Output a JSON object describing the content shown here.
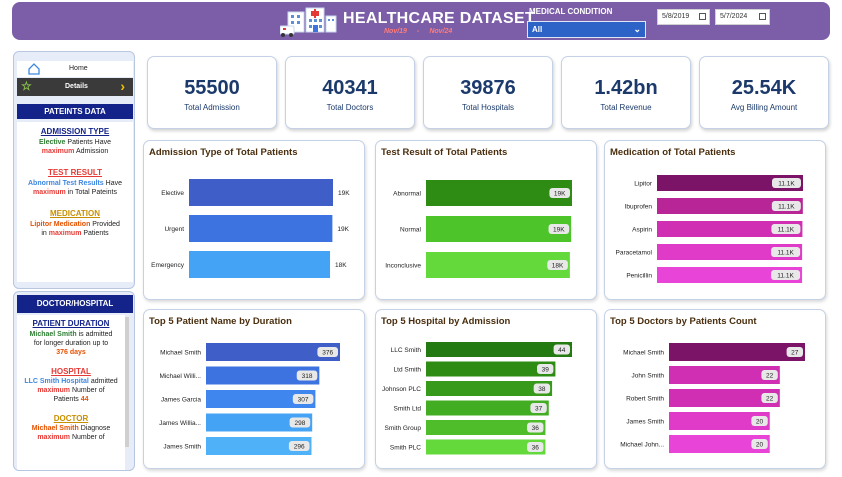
{
  "header": {
    "title": "HEALTHCARE DATASET",
    "range_start": "Nov/19",
    "range_sep": "-",
    "range_end": "Nov/24",
    "medical_condition_label": "MEDICAL CONDITION",
    "medical_condition_value": "All",
    "date_from": "5/8/2019",
    "date_to": "5/7/2024",
    "bg_color": "#7b5ea7",
    "select_color": "#2d62c7"
  },
  "sidebar": {
    "home_label": "Home",
    "details_label": "Details",
    "patients_heading": "PATEINTS DATA",
    "admission": {
      "title": "ADMISSION TYPE",
      "l1a": "Elective",
      "l1b": "Patients Have",
      "l2a": "maximum",
      "l2b": "Admission"
    },
    "test": {
      "title": "TEST RESULT",
      "l1a": "Abnormal Test Results",
      "l1b": "Have",
      "l2a": "maximum",
      "l2b": "in Total Pateints"
    },
    "medication": {
      "title": "MEDICATION",
      "l1a": "Lipitor Medication",
      "l1b": "Provided",
      "l2a": "in",
      "l2b": "maximum",
      "l2c": "Patients"
    },
    "doctor_heading": "DOCTOR/HOSPITAL",
    "duration": {
      "title": "PATIENT DURATION",
      "l1": "Michael Smith",
      "l1b": "is admitted",
      "l2": "for longer duration up to",
      "l3": "376 days"
    },
    "hospital": {
      "title": "HOSPITAL",
      "l1a": "LLC Smith Hospital",
      "l1b": "admitted",
      "l2a": "maximum",
      "l2b": "Number of",
      "l3a": "Patients",
      "l3b": "44"
    },
    "doctor": {
      "title": "DOCTOR",
      "l1a": "Michael Smith",
      "l1b": "Diagnose",
      "l2a": "maximum",
      "l2b": "Number of"
    }
  },
  "kpis": [
    {
      "value": "55500",
      "label": "Total Admission"
    },
    {
      "value": "40341",
      "label": "Total Doctors"
    },
    {
      "value": "39876",
      "label": "Total Hospitals"
    },
    {
      "value": "1.42bn",
      "label": "Total Revenue"
    },
    {
      "value": "25.54K",
      "label": "Avg Billing Amount"
    }
  ],
  "chart_data": [
    {
      "type": "bar",
      "title": "Admission Type of Total Patients",
      "categories": [
        "Elective",
        "Urgent",
        "Emergency"
      ],
      "values": [
        18655,
        18576,
        18269
      ],
      "labels": [
        "19K",
        "19K",
        "18K"
      ],
      "colors": [
        "#3f5ec8",
        "#3d73e0",
        "#45a3f5"
      ],
      "label_style": "outside"
    },
    {
      "type": "bar",
      "title": "Test Result of Total Patients",
      "categories": [
        "Abnormal",
        "Normal",
        "Inconclusive"
      ],
      "values": [
        18627,
        18517,
        18356
      ],
      "labels": [
        "19K",
        "19K",
        "18K"
      ],
      "colors": [
        "#2e8b14",
        "#4cc42a",
        "#63d93c"
      ],
      "label_style": "pill"
    },
    {
      "type": "bar",
      "title": "Medication of Total Patients",
      "categories": [
        "Lipitor",
        "Ibuprofen",
        "Aspirin",
        "Paracetamol",
        "Penicillin"
      ],
      "values": [
        11140,
        11127,
        11094,
        11071,
        11068
      ],
      "labels": [
        "11.1K",
        "11.1K",
        "11.1K",
        "11.1K",
        "11.1K"
      ],
      "colors": [
        "#7b1466",
        "#b72596",
        "#d02fb3",
        "#e03bc8",
        "#e844d8"
      ],
      "label_style": "pill"
    },
    {
      "type": "bar",
      "title": "Top 5 Patient Name by Duration",
      "categories": [
        "Michael Smith",
        "Michael Willi...",
        "James Garcia",
        "James Willia...",
        "James Smith"
      ],
      "values": [
        376,
        318,
        307,
        298,
        296
      ],
      "labels": [
        "376",
        "318",
        "307",
        "298",
        "296"
      ],
      "colors": [
        "#3f5ec8",
        "#3d73e0",
        "#3f86ee",
        "#45a3f5",
        "#4fb1f7"
      ],
      "label_style": "pill",
      "xlim": [
        0,
        376
      ]
    },
    {
      "type": "bar",
      "title": "Top 5 Hospital by Admission",
      "categories": [
        "LLC Smith",
        "Ltd Smith",
        "Johnson PLC",
        "Smith Ltd",
        "Smith Group",
        "Smith PLC"
      ],
      "values": [
        44,
        39,
        38,
        37,
        36,
        36
      ],
      "labels": [
        "44",
        "39",
        "38",
        "37",
        "36",
        "36"
      ],
      "colors": [
        "#237a10",
        "#2e8b14",
        "#379a1b",
        "#42ad22",
        "#4fbd2a",
        "#63d93c"
      ],
      "label_style": "pill"
    },
    {
      "type": "bar",
      "title": "Top 5 Doctors by Patients Count",
      "categories": [
        "Michael Smith",
        "John Smith",
        "Robert Smith",
        "James Smith",
        "Michael John..."
      ],
      "values": [
        27,
        22,
        22,
        20,
        20
      ],
      "labels": [
        "27",
        "22",
        "22",
        "20",
        "20"
      ],
      "colors": [
        "#7b1466",
        "#d02fb3",
        "#d02fb3",
        "#e03bc8",
        "#e844d8"
      ],
      "label_style": "pill"
    }
  ]
}
